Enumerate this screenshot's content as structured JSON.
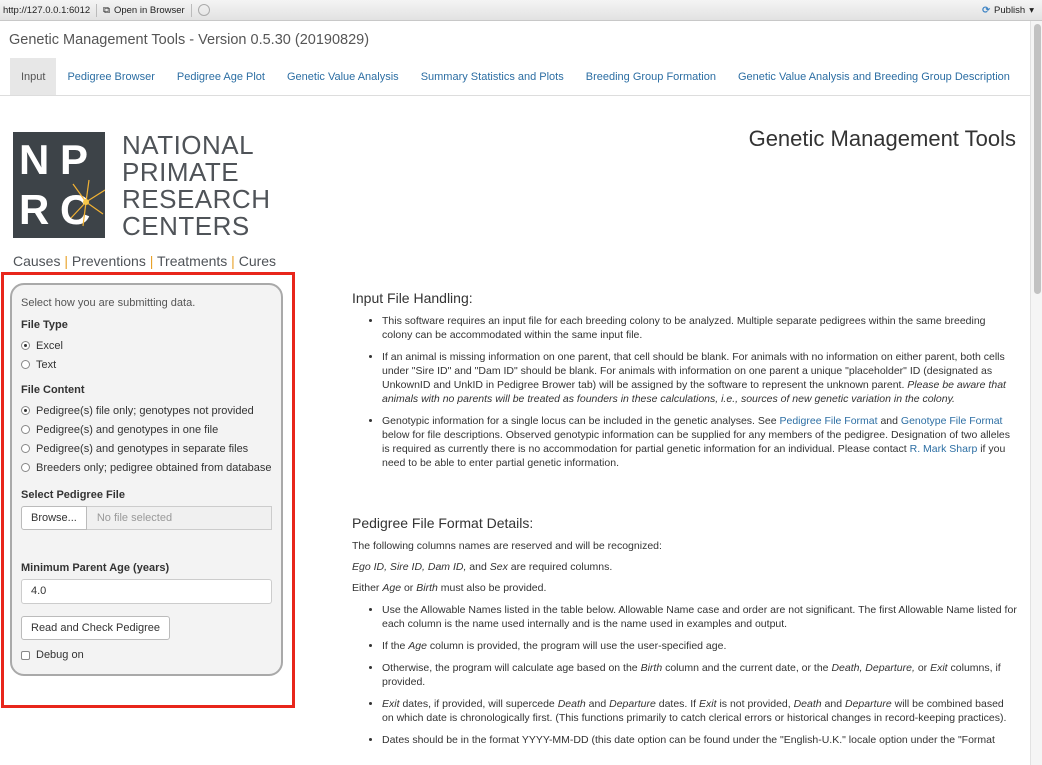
{
  "browser": {
    "url": "http://127.0.0.1:6012",
    "open_in_browser": "Open in Browser",
    "publish": "Publish"
  },
  "app": {
    "title": "Genetic Management Tools - Version 0.5.30 (20190829)"
  },
  "tabs": [
    {
      "label": "Input"
    },
    {
      "label": "Pedigree Browser"
    },
    {
      "label": "Pedigree Age Plot"
    },
    {
      "label": "Genetic Value Analysis"
    },
    {
      "label": "Summary Statistics and Plots"
    },
    {
      "label": "Breeding Group Formation"
    },
    {
      "label": "Genetic Value Analysis and Breeding Group Description"
    }
  ],
  "logo": {
    "letters": [
      "N",
      "P",
      "R",
      "C"
    ],
    "name_lines": [
      "NATIONAL",
      "PRIMATE",
      "RESEARCH",
      "CENTERS"
    ],
    "tagline": [
      "Causes",
      "Preventions",
      "Treatments",
      "Cures"
    ]
  },
  "sidebar": {
    "hint": "Select how you are submitting data.",
    "file_type_label": "File Type",
    "file_type_options": [
      "Excel",
      "Text"
    ],
    "file_type_selected": 0,
    "file_content_label": "File Content",
    "file_content_options": [
      "Pedigree(s) file only; genotypes not provided",
      "Pedigree(s) and genotypes in one file",
      "Pedigree(s) and genotypes in separate files",
      "Breeders only; pedigree obtained from database"
    ],
    "file_content_selected": 0,
    "pedigree_file_label": "Select Pedigree File",
    "browse_label": "Browse...",
    "no_file": "No file selected",
    "min_age_label": "Minimum Parent Age (years)",
    "min_age_value": "4.0",
    "read_button": "Read and Check Pedigree",
    "debug_label": "Debug on",
    "debug_checked": false
  },
  "main": {
    "title": "Genetic Management Tools",
    "input_heading": "Input File Handling:",
    "input_bullets": {
      "b1": "This software requires an input file for each breeding colony to be analyzed. Multiple separate pedigrees within the same breeding colony can be accommodated within the same input file.",
      "b2_text": "If an animal is missing information on one parent, that cell should be blank. For animals with no information on either parent, both cells under \"Sire ID\" and \"Dam ID\" should be blank. For animals with information on one parent a unique \"placeholder\" ID (designated as UnkownID and UnkID in Pedigree Brower tab) will be assigned by the software to represent the unknown parent.",
      "b2_italic": "Please be aware that animals with no parents will be treated as founders in these calculations, i.e., sources of new genetic variation in the colony.",
      "b3_a": "Genotypic information for a single locus can be included in the genetic analyses. See",
      "b3_link1": "Pedigree File Format",
      "b3_and": "and",
      "b3_link2": "Genotype File Format",
      "b3_b": "below for file descriptions. Observed genotypic information can be supplied for any members of the pedigree. Designation of two alleles is required as currently there is no accommodation for partial genetic information for an individual. Please contact",
      "b3_link3": "R. Mark Sharp",
      "b3_c": "if you need to be able to enter partial genetic information."
    },
    "pedigree_heading": "Pedigree File Format Details:",
    "pedigree_intro": "The following columns names are reserved and will be recognized:",
    "required_cols_italic": "Ego ID, Sire ID, Dam ID,",
    "required_and": "and",
    "required_sex": "Sex",
    "required_rest": "are required columns.",
    "either_a": "Either",
    "either_age": "Age",
    "either_or": "or",
    "either_birth": "Birth",
    "either_rest": "must also be provided.",
    "ped_bullets": {
      "p1": "Use the Allowable Names listed in the table below. Allowable Name case and order are not significant. The first Allowable Name listed for each column is the name used internally and is the name used in examples and output.",
      "p2_a": "If the",
      "p2_age": "Age",
      "p2_b": "column is provided, the program will use the user-specified age.",
      "p3_a": "Otherwise, the program will calculate age based on the",
      "p3_birth": "Birth",
      "p3_b": "column and the current date, or the",
      "p3_cols": "Death, Departure,",
      "p3_or": "or",
      "p3_exit": "Exit",
      "p3_c": "columns, if provided.",
      "p4_exit": "Exit",
      "p4_a": "dates, if provided, will supercede",
      "p4_death": "Death",
      "p4_and": "and",
      "p4_departure": "Departure",
      "p4_b": "dates. If",
      "p4_exit2": "Exit",
      "p4_c": "is not provided,",
      "p4_death2": "Death",
      "p4_and2": "and",
      "p4_departure2": "Departure",
      "p4_d": "will be combined based on which date is chronologically first. (This functions primarily to catch clerical errors or historical changes in record-keeping practices).",
      "p5": "Dates should be in the format YYYY-MM-DD (this date option can be found under the \"English-U.K.\" locale option under the \"Format"
    }
  }
}
